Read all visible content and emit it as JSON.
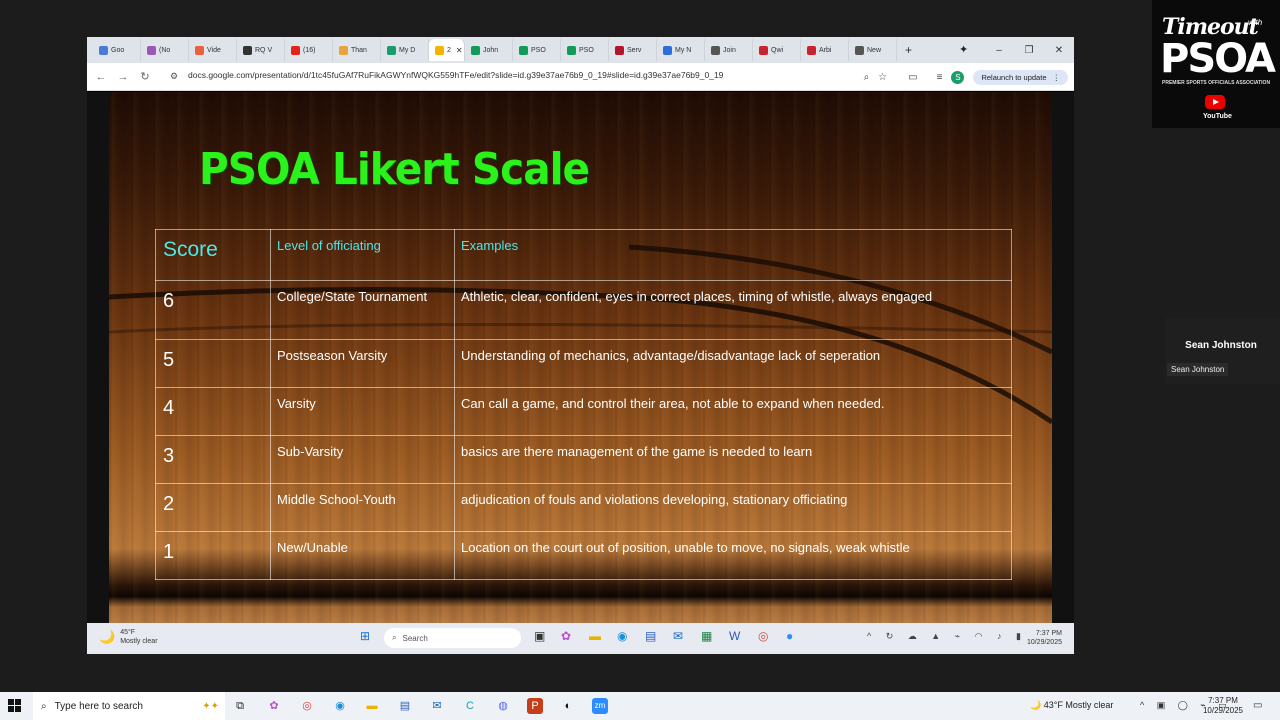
{
  "browser": {
    "tabs": [
      {
        "label": "Goo",
        "color": "#4a7bd8"
      },
      {
        "label": "(No",
        "color": "#9b59b6"
      },
      {
        "label": "Vide",
        "color": "#e8613c"
      },
      {
        "label": "RQ V",
        "color": "#333333"
      },
      {
        "label": "(16)",
        "color": "#e62117"
      },
      {
        "label": "Than",
        "color": "#e8a33c"
      },
      {
        "label": "My D",
        "color": "#1a9c6b"
      },
      {
        "label": "",
        "color": "#f4b400",
        "active": true
      },
      {
        "label": "John",
        "color": "#0f9d58"
      },
      {
        "label": "PSO",
        "color": "#0f9d58"
      },
      {
        "label": "PSO",
        "color": "#0f9d58"
      },
      {
        "label": "Serv",
        "color": "#b3152b"
      },
      {
        "label": "My N",
        "color": "#2d6fd6"
      },
      {
        "label": "Join",
        "color": "#555555"
      },
      {
        "label": "Qwi",
        "color": "#c7252e"
      },
      {
        "label": "Arbi",
        "color": "#c7252e"
      },
      {
        "label": "New",
        "color": "#555555"
      }
    ],
    "active_tab_number": "2",
    "url": "docs.google.com/presentation/d/1tc45fuGAf7RuFikAGWYnfWQKG559hTFe/edit?slide=id.g39e37ae76b9_0_19#slide=id.g39e37ae76b9_0_19",
    "avatar_letter": "S",
    "relaunch_label": "Relaunch to update"
  },
  "slide": {
    "title": "PSOA Likert Scale",
    "headers": {
      "score": "Score",
      "level": "Level of officiating",
      "examples": "Examples"
    },
    "rows": [
      {
        "score": "6",
        "level": "College/State Tournament",
        "example": "Athletic, clear, confident, eyes in correct places, timing of whistle, always engaged"
      },
      {
        "score": "5",
        "level": "Postseason Varsity",
        "example": "Understanding of mechanics, advantage/disadvantage lack of seperation"
      },
      {
        "score": "4",
        "level": "Varsity",
        "example": "Can call a game, and control their area, not able to expand when needed."
      },
      {
        "score": "3",
        "level": "Sub-Varsity",
        "example": "basics are there management of the game is needed to learn"
      },
      {
        "score": "2",
        "level": "Middle School-Youth",
        "example": "adjudication of fouls and violations developing, stationary officiating"
      },
      {
        "score": "1",
        "level": "New/Unable",
        "example": "Location on the court out of position, unable to move, no signals, weak whistle"
      }
    ]
  },
  "remote_taskbar": {
    "temp": "45°F",
    "condition": "Mostly clear",
    "search": "Search",
    "time": "7:37 PM",
    "date": "10/29/2025"
  },
  "logo": {
    "line1": "Timeout",
    "with": "with",
    "line2": "PSOA",
    "tagline": "PREMIER SPORTS OFFICIALS ASSOCIATION",
    "platform": "YouTube"
  },
  "participant": {
    "name": "Sean Johnston",
    "label": "Sean Johnston"
  },
  "host_taskbar": {
    "search_placeholder": "Type here to search",
    "weather": "43°F  Mostly clear",
    "time": "7:37 PM",
    "date": "10/29/2025"
  }
}
